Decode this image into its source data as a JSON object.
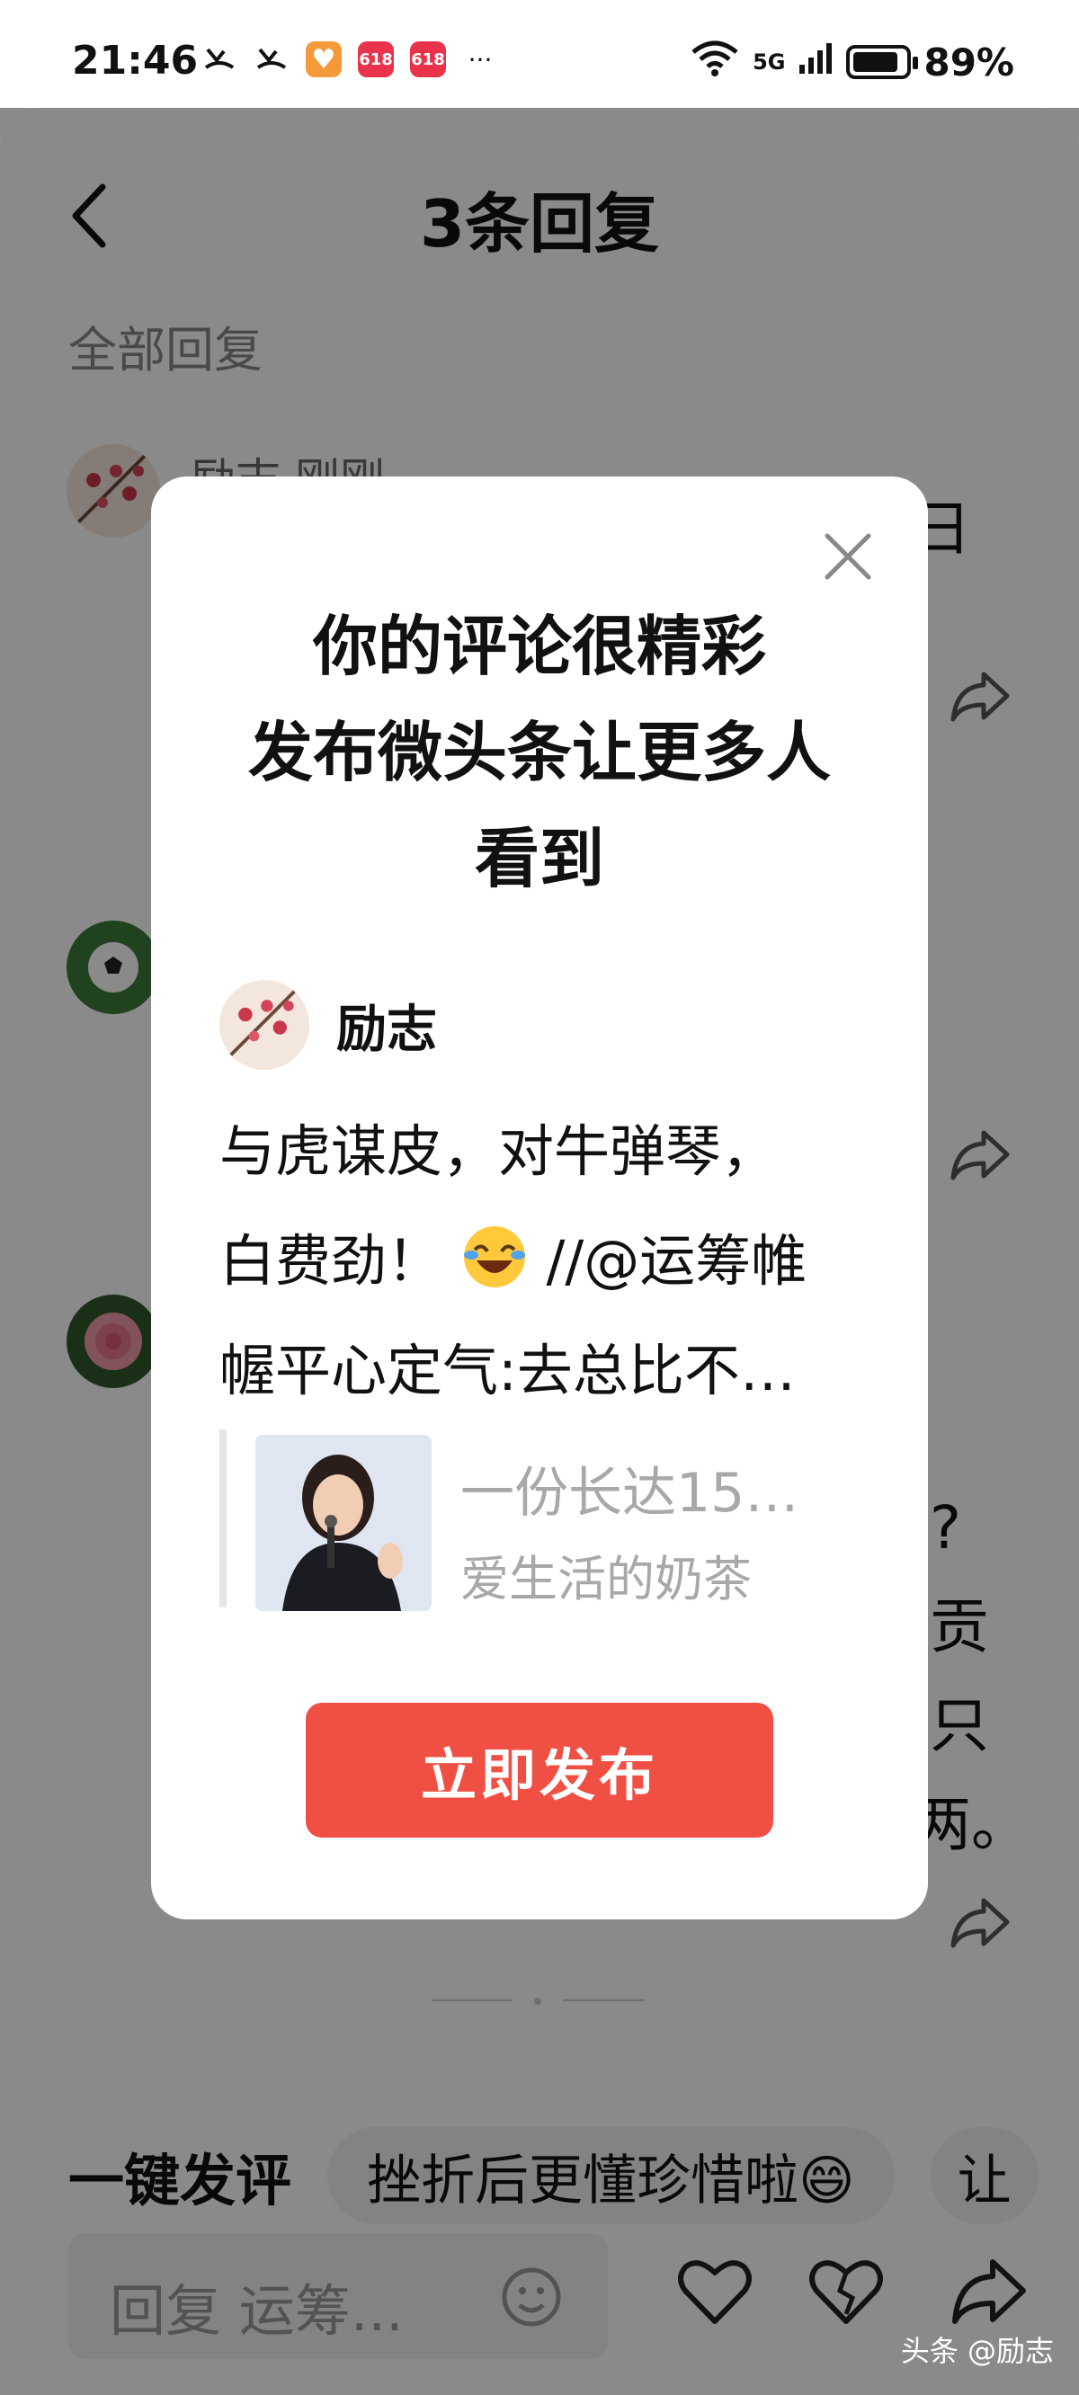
{
  "status_bar": {
    "time": "21:46",
    "network": "5G",
    "battery": "89%",
    "more": "···",
    "badge_618": "618"
  },
  "header": {
    "title": "3条回复",
    "section_label": "全部回复"
  },
  "comments": [
    {
      "name": "励志 刚刚",
      "partial_text": "日"
    },
    {
      "name": "",
      "partial_text": ""
    },
    {
      "name": "",
      "partial_lines": [
        "?",
        "贡",
        "只",
        "两。"
      ]
    }
  ],
  "quick_reply": {
    "label": "一键发评",
    "chip": "挫折后更懂珍惜啦😄",
    "chip2": "让"
  },
  "bottom_bar": {
    "reply_placeholder": "回复 运筹..."
  },
  "watermark": "头条 @励志",
  "modal": {
    "headline_line1": "你的评论很精彩",
    "headline_line2": "发布微头条让更多人",
    "headline_line3": "看到",
    "author_name": "励志",
    "body_line1": "与虎谋皮，对牛弹琴，",
    "body_line2_a": "白费劲！",
    "body_line2_b": "//@运筹帷",
    "body_line3": "幄平心定气:去总比不…",
    "quote_title": "一份长达15…",
    "quote_source": "爱生活的奶茶",
    "publish_label": "立即发布"
  },
  "colors": {
    "publish_button": "#f04f43",
    "overlay": "rgba(0,0,0,0.46)",
    "muted_text": "#a8a8a8"
  }
}
